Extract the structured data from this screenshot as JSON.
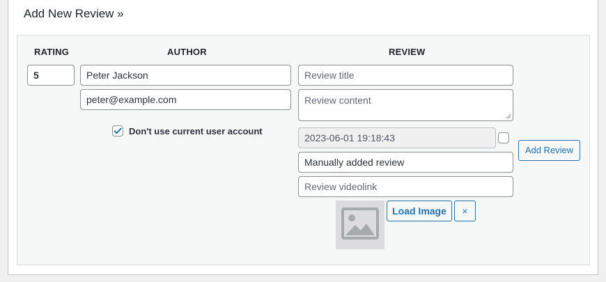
{
  "title": "Add New Review »",
  "columns": {
    "rating": "RATING",
    "author": "AUTHOR",
    "review": "REVIEW"
  },
  "rating": {
    "value": "5"
  },
  "author": {
    "name": "Peter Jackson",
    "email": "peter@example.com",
    "dont_use_account_label": "Don't use current user account",
    "dont_use_account_checked": true
  },
  "review": {
    "title_placeholder": "Review title",
    "content_placeholder": "Review content",
    "date": "2023-06-01 19:18:43",
    "date_edit_checked": false,
    "source": "Manually added review",
    "videolink_placeholder": "Review videolink",
    "load_image_label": "Load Image",
    "remove_image_label": "×",
    "image_icon": "image-placeholder-icon"
  },
  "add_review_label": "Add Review",
  "colors": {
    "accent": "#2271b1",
    "check": "#2271b1",
    "panel_bg": "#f6f7f7",
    "page_bg": "#f0f0f1"
  }
}
